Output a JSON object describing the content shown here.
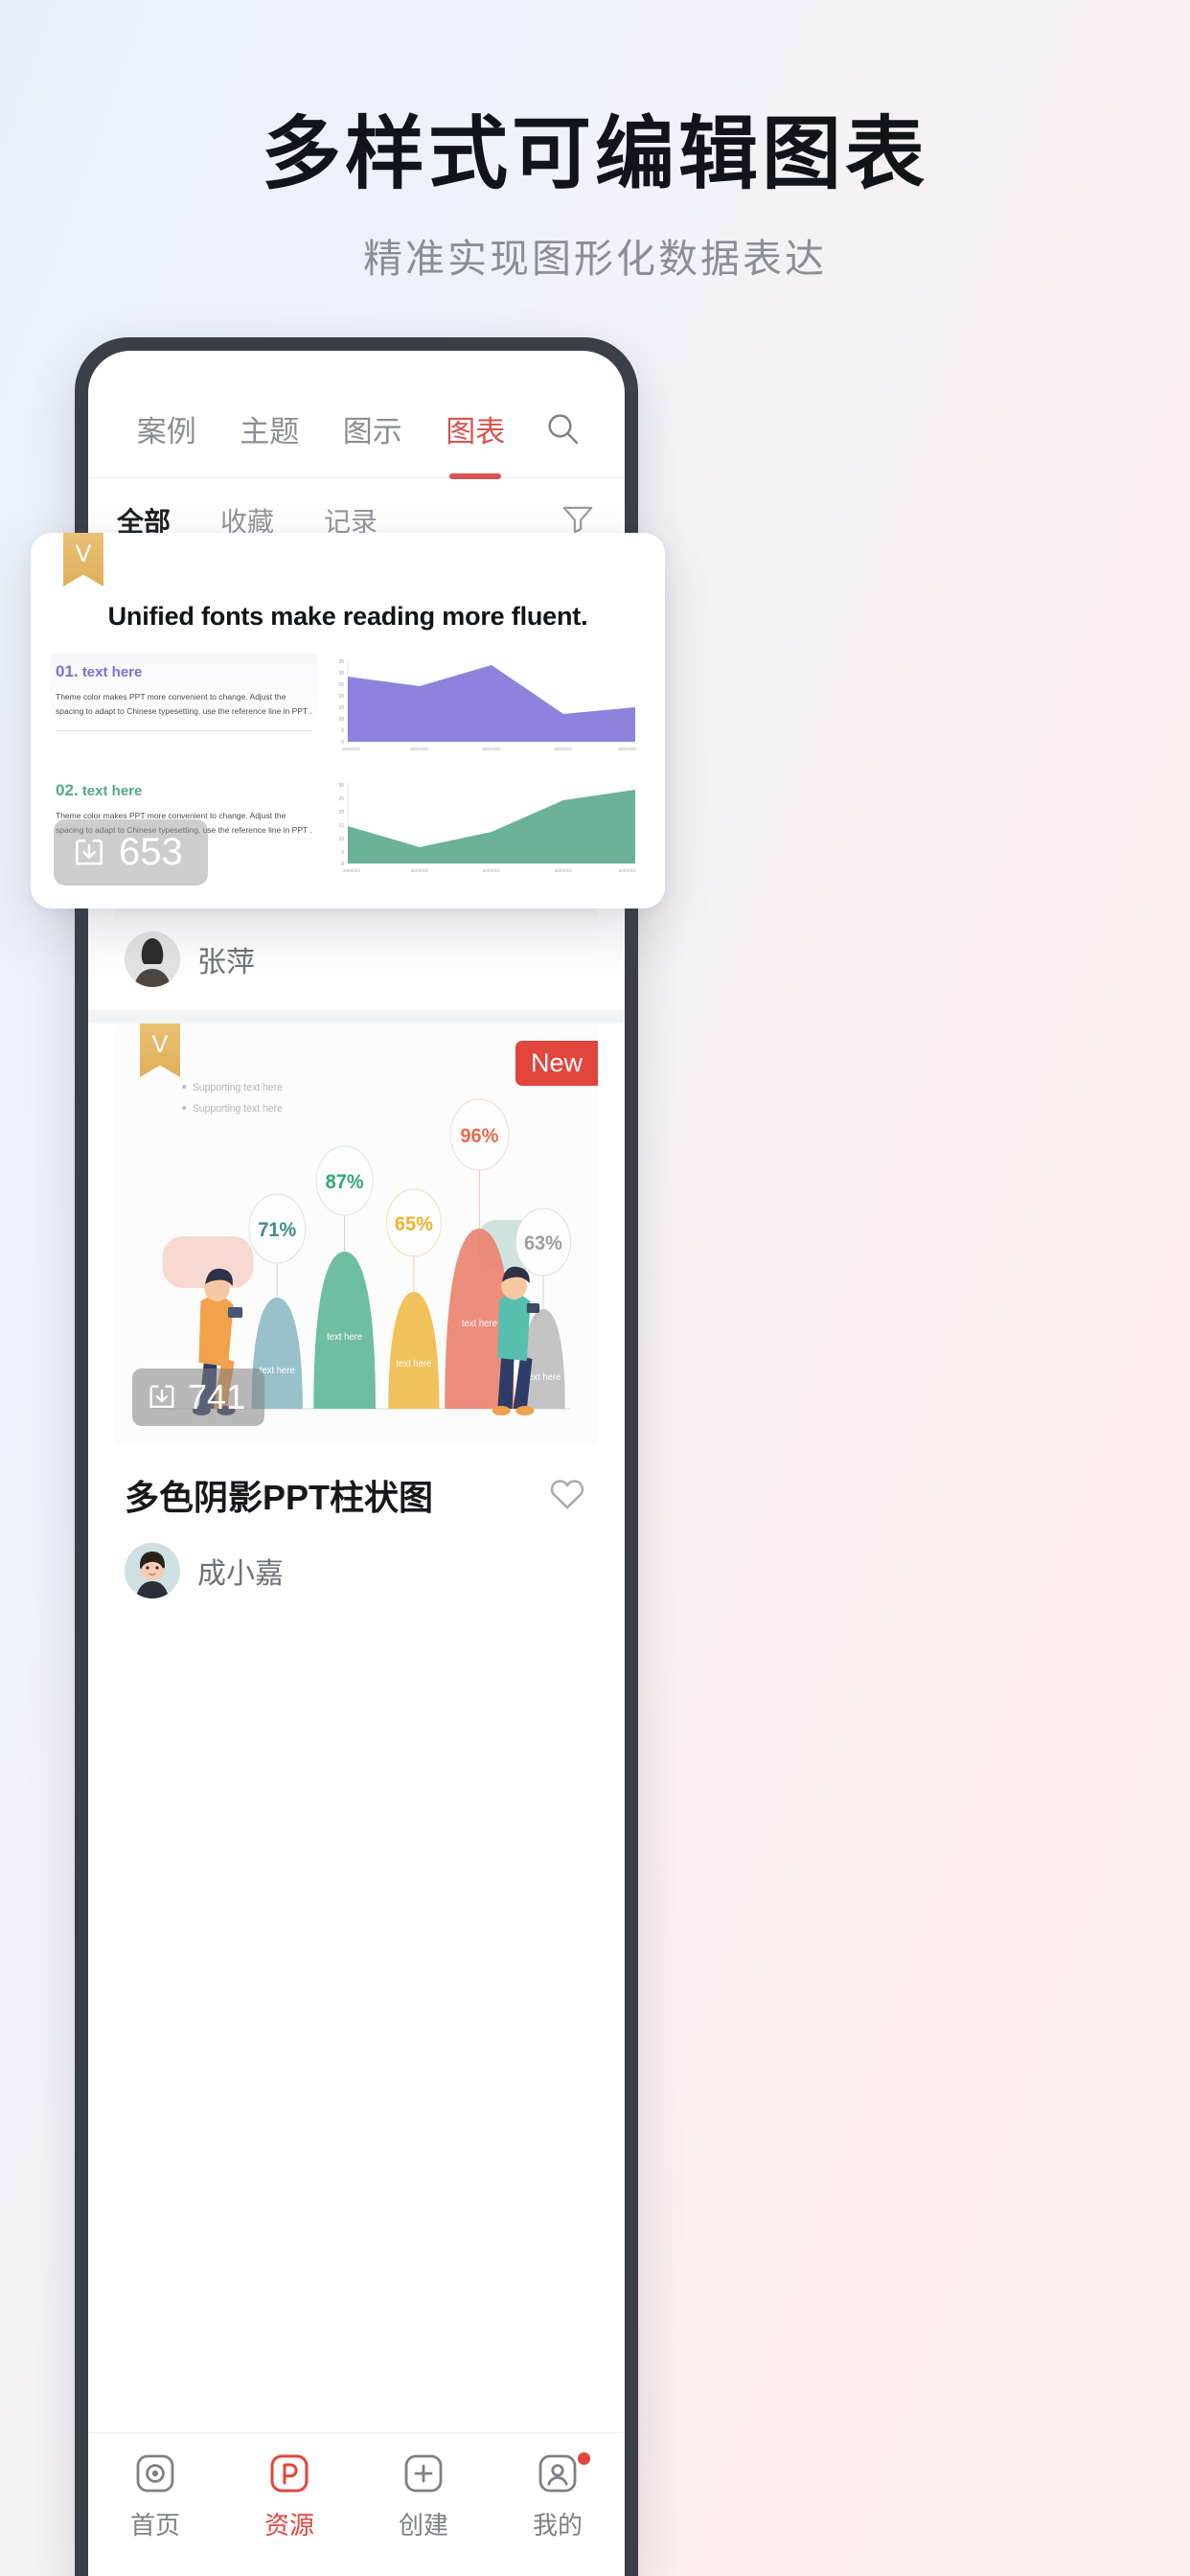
{
  "hero": {
    "title": "多样式可编辑图表",
    "subtitle": "精准实现图形化数据表达"
  },
  "app": {
    "tabs": [
      {
        "label": "案例",
        "active": false
      },
      {
        "label": "主题",
        "active": false
      },
      {
        "label": "图示",
        "active": false
      },
      {
        "label": "图表",
        "active": true
      }
    ],
    "search_icon": "search-icon",
    "filters": [
      {
        "label": "全部",
        "active": true
      },
      {
        "label": "收藏",
        "active": false
      },
      {
        "label": "记录",
        "active": false
      }
    ],
    "filter_icon": "funnel-icon",
    "accent_color": "#d9534f",
    "new_badge_color": "#e2453c"
  },
  "overlay_card": {
    "vip_badge": "V",
    "headline": "Unified fonts make reading more fluent.",
    "download_icon": "download-icon",
    "download_count": "653",
    "blocks": [
      {
        "number": "01.",
        "title": "text here",
        "color": "#7b6fd4",
        "body": "Theme color makes PPT more convenient to change. Adjust the spacing to adapt to Chinese typesetting, use the reference line in PPT ."
      },
      {
        "number": "02.",
        "title": "text here",
        "color": "#54a98b",
        "body": "Theme color makes PPT more convenient to change. Adjust the spacing to adapt to Chinese typesetting, use the reference line in PPT ."
      }
    ]
  },
  "chart_data": [
    {
      "type": "area",
      "title": "01. text here",
      "color": "#7b6fd4",
      "categories": [
        "20XX/X/X",
        "20XX/X/X",
        "20XX/X/X",
        "20XX/X/X",
        "20XX/X/X"
      ],
      "values": [
        28,
        24,
        33,
        12,
        15
      ],
      "yticks": [
        0,
        5,
        10,
        15,
        20,
        25,
        30,
        35
      ],
      "ylim": [
        0,
        35
      ],
      "xlabel": "",
      "ylabel": "",
      "grid": false,
      "legend": "none"
    },
    {
      "type": "area",
      "title": "02. text here",
      "color": "#54a98b",
      "categories": [
        "20XX/X/X",
        "20XX/X/X",
        "20XX/X/X",
        "20XX/X/X",
        "20XX/X/X"
      ],
      "values": [
        14,
        6,
        12,
        24,
        28
      ],
      "yticks": [
        0,
        5,
        10,
        15,
        20,
        25,
        30
      ],
      "ylim": [
        0,
        30
      ],
      "xlabel": "",
      "ylabel": "",
      "grid": false,
      "legend": "none"
    },
    {
      "type": "bar",
      "title": "多色阴影PPT柱状图",
      "categories": [
        "text here",
        "text here",
        "text here",
        "text here",
        "text here"
      ],
      "values": [
        71,
        87,
        65,
        96,
        63
      ],
      "value_labels": [
        "71%",
        "87%",
        "65%",
        "96%",
        "63%"
      ],
      "colors": [
        "#8fbcc6",
        "#62b99a",
        "#f0bc4e",
        "#ec8370",
        "#b9b9b9"
      ],
      "annotations": [
        "Supporting text here",
        "Supporting text here"
      ],
      "ylim": [
        0,
        100
      ],
      "grid": false,
      "legend": "none"
    }
  ],
  "feed": [
    {
      "vip_badge": "V",
      "author": "张萍"
    },
    {
      "vip_badge": "V",
      "new_badge": "New",
      "download_icon": "download-icon",
      "download_count": "741",
      "title": "多色阴影PPT柱状图",
      "like_icon": "heart-icon",
      "author": "成小嘉",
      "bullets": [
        "Supporting text here",
        "Supporting text here"
      ],
      "bar_labels": [
        "71%",
        "87%",
        "65%",
        "96%",
        "63%"
      ],
      "bar_captions": [
        "text here",
        "text here",
        "text here",
        "text here",
        "text here"
      ]
    }
  ],
  "bottom_nav": [
    {
      "label": "首页",
      "icon": "home-camera-icon",
      "active": false,
      "dot": false
    },
    {
      "label": "资源",
      "icon": "p-resource-icon",
      "active": true,
      "dot": false
    },
    {
      "label": "创建",
      "icon": "plus-square-icon",
      "active": false,
      "dot": false
    },
    {
      "label": "我的",
      "icon": "user-profile-icon",
      "active": false,
      "dot": true
    }
  ]
}
